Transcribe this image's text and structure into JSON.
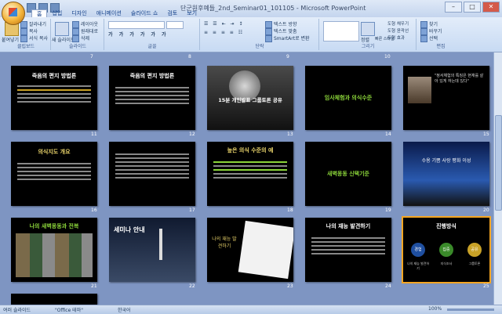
{
  "window": {
    "title": "단군원후예들_2nd_Seminar01_101105 - Microsoft PowerPoint",
    "controls": [
      "–",
      "□",
      "✕"
    ]
  },
  "ribbon": {
    "tabs": [
      "홈",
      "삽입",
      "디자인",
      "애니메이션",
      "슬라이드 쇼",
      "검토",
      "보기"
    ],
    "active_tab": "홈",
    "groups": [
      "클립보드",
      "슬라이드",
      "글꼴",
      "단락",
      "그리기",
      "편집"
    ],
    "clipboard": {
      "paste": "붙여넣기",
      "cut": "잘라내기",
      "copy": "복사",
      "format_painter": "서식 복사"
    },
    "slides": {
      "new_slide": "새 슬라이드",
      "layout": "레이아웃",
      "reset": "원래대로",
      "delete": "삭제"
    },
    "paragraph": {
      "text_direction": "텍스트 방향",
      "align_text": "텍스트 맞춤",
      "smartart": "SmartArt로 변환"
    },
    "drawing": {
      "arrange": "정렬",
      "quick_styles": "빠른 스타일",
      "shape_fill": "도형 채우기",
      "shape_outline": "도형 윤곽선",
      "shape_effects": "도형 효과"
    },
    "editing": {
      "find": "찾기",
      "replace": "바꾸기",
      "select": "선택"
    }
  },
  "status": {
    "mode": "여러 슬라이드",
    "theme": "\"Office 테마\"",
    "language": "한국어",
    "zoom": "100%"
  },
  "row_top_numbers": [
    "7",
    "8",
    "9",
    "10"
  ],
  "slides": [
    {
      "num": "11",
      "title": "죽음의 편지 방법론"
    },
    {
      "num": "12",
      "title": "죽음의 편지 방법론"
    },
    {
      "num": "13",
      "title": "15분 개인발표 그룹토론 공유"
    },
    {
      "num": "14",
      "title": "임사체험과 의식수준"
    },
    {
      "num": "15",
      "title": "\"정서체험의 특징은 현재를 살아 있게 하는데 있다\""
    },
    {
      "num": "16",
      "title": "의식지도 개요"
    },
    {
      "num": "17",
      "title": ""
    },
    {
      "num": "18",
      "title": "높은 의식 수준의 예"
    },
    {
      "num": "19",
      "title": "새벽몽동 신택기준"
    },
    {
      "num": "20",
      "title": "수용 기쁨 사랑 평화 이성"
    },
    {
      "num": "21",
      "title": "나의 새벽몽동과 전복"
    },
    {
      "num": "22",
      "title": "세미나 안내"
    },
    {
      "num": "23",
      "title": "나의 재능 발견하기"
    },
    {
      "num": "24",
      "title": "나의 재능 발견하기"
    },
    {
      "num": "25",
      "title": "진행방식"
    }
  ],
  "slide25": {
    "circles": [
      "경험",
      "집중",
      "공유"
    ],
    "labels": [
      "나의 재능 발견하기",
      "지식조사",
      "그룹토론"
    ]
  }
}
